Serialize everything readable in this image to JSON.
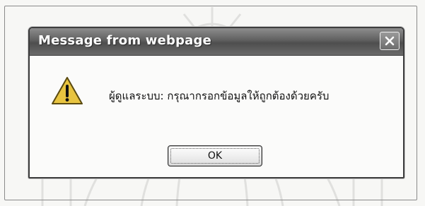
{
  "dialog": {
    "title": "Message from webpage",
    "message": "ผู้ดูแลระบบ: กรุณากรอกข้อมูลให้ถูกต้องด้วยครับ",
    "ok_label": "OK"
  },
  "icons": {
    "warning": "warning-icon",
    "close": "close-icon",
    "watermark": "watermark-emblem"
  },
  "colors": {
    "titlebar": "#5f5f5f",
    "title_text": "#ffffff",
    "dialog_border": "#3d3d3d",
    "warning_fill": "#e8c440"
  }
}
